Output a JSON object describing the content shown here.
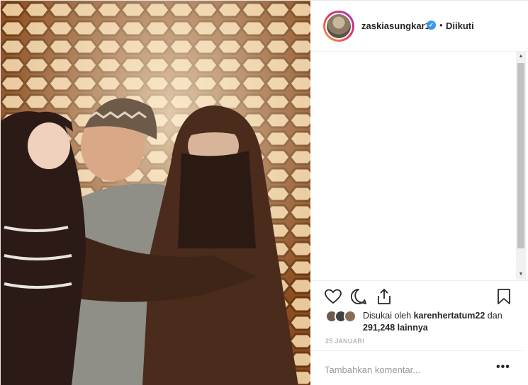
{
  "photo": {
    "icon": "family-photo"
  },
  "header": {
    "username": "zaskiasungkar15",
    "separator": "•",
    "follow_status": "Diikuti",
    "verified_icon": "verified-badge-icon"
  },
  "actions": {
    "like_icon": "heart-icon",
    "comment_icon": "comment-icon",
    "share_icon": "share-icon",
    "save_icon": "bookmark-icon"
  },
  "likes": {
    "prefix": "Disukai oleh ",
    "user": "karenhertatum22",
    "middle": " dan",
    "count_text": "291,248 lainnya"
  },
  "date": "25 JANUARI",
  "comment": {
    "placeholder": "Tambahkan komentar...",
    "more_label": "•••"
  },
  "colors": {
    "accent": "#3897f0",
    "text": "#262626",
    "muted": "#999999"
  }
}
